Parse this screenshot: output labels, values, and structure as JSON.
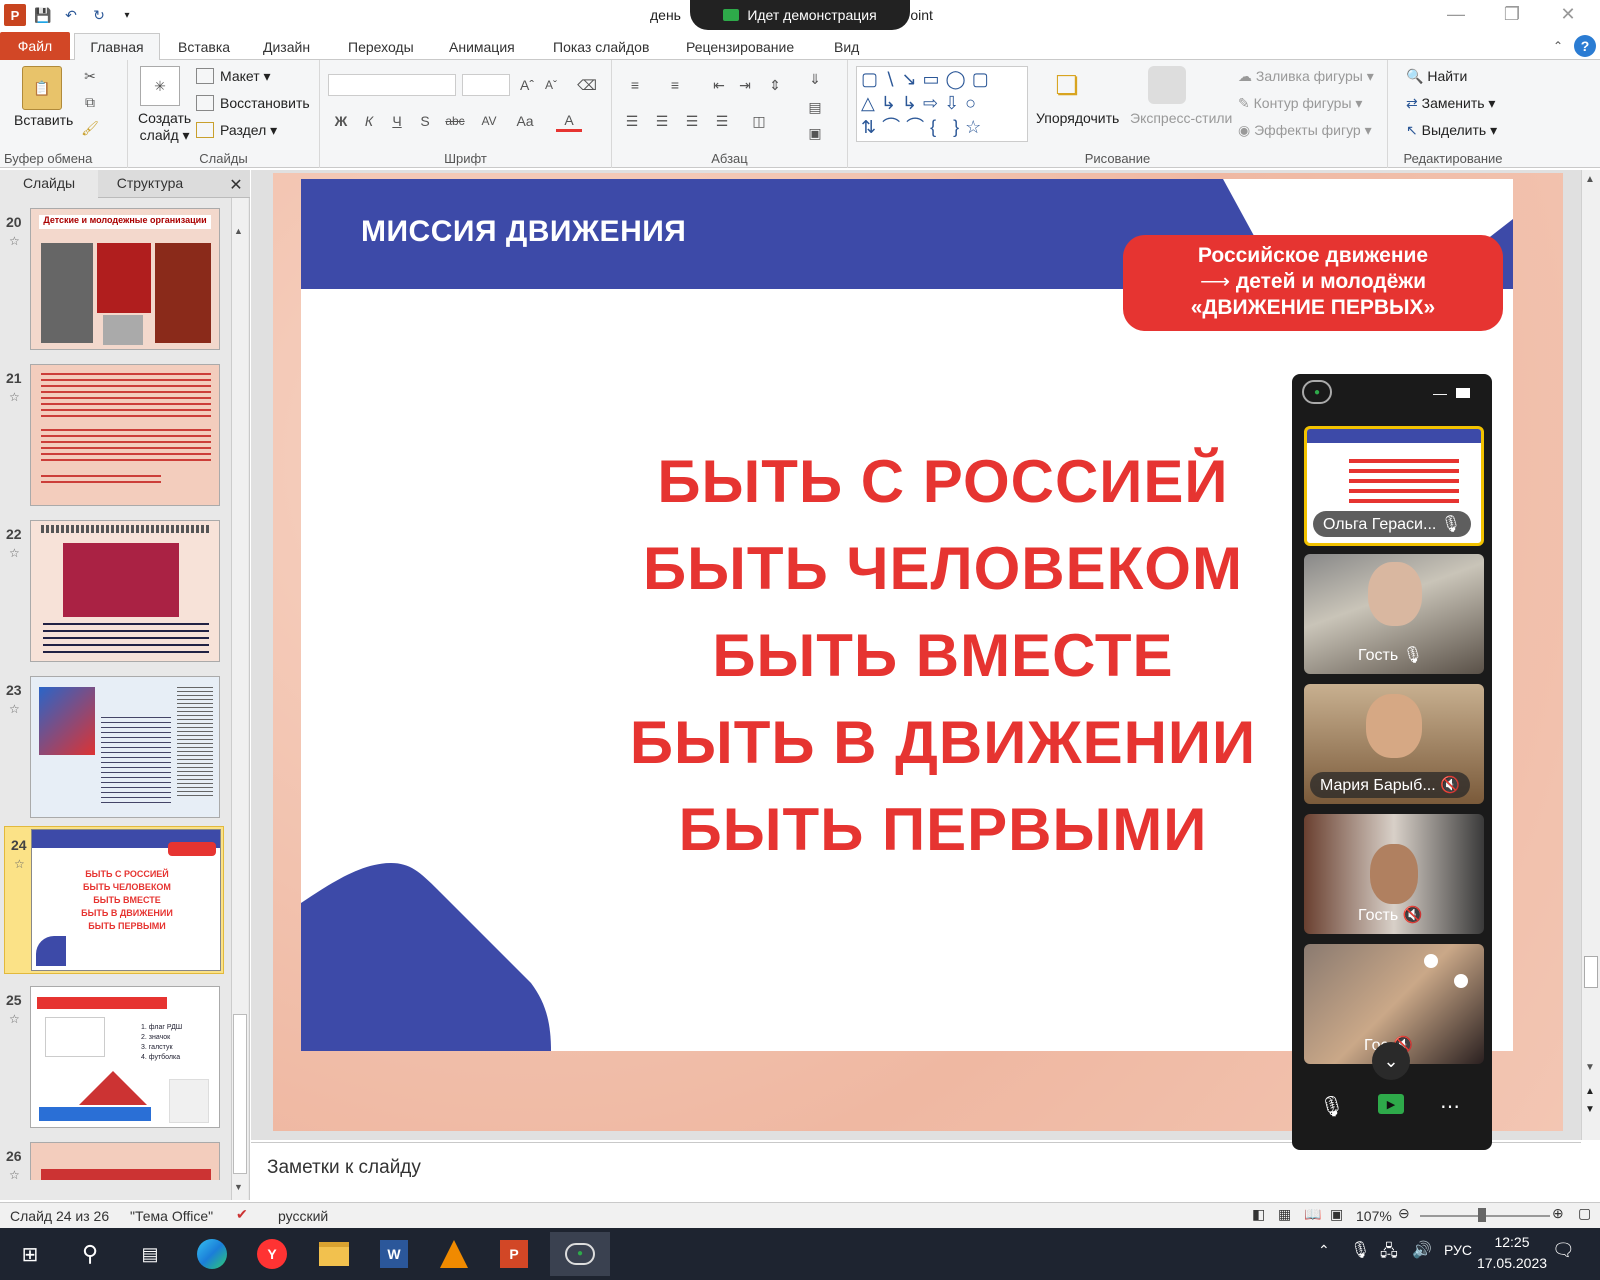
{
  "titlebar": {
    "title_left": "день",
    "title_right": "Point",
    "share_label": "Идет демонстрация",
    "app_badge": "P"
  },
  "tabs": [
    {
      "label": "Файл"
    },
    {
      "label": "Главная"
    },
    {
      "label": "Вставка"
    },
    {
      "label": "Дизайн"
    },
    {
      "label": "Переходы"
    },
    {
      "label": "Анимация"
    },
    {
      "label": "Показ слайдов"
    },
    {
      "label": "Рецензирование"
    },
    {
      "label": "Вид"
    }
  ],
  "ribbon": {
    "clipboard": {
      "paste": "Вставить",
      "label": "Буфер обмена"
    },
    "slides": {
      "new_slide_1": "Создать",
      "new_slide_2": "слайд",
      "layout": "Макет",
      "reset": "Восстановить",
      "section": "Раздел",
      "label": "Слайды"
    },
    "font": {
      "label": "Шрифт",
      "bold": "Ж",
      "italic": "К",
      "underline": "Ч",
      "shadow": "S",
      "strike": "abc",
      "spacing": "AV",
      "case": "Aa",
      "color": "A"
    },
    "paragraph": {
      "label": "Абзац"
    },
    "drawing": {
      "arrange": "Упорядочить",
      "quick_styles": "Экспресс-стили",
      "fill": "Заливка фигуры",
      "outline": "Контур фигуры",
      "effects": "Эффекты фигур",
      "label": "Рисование"
    },
    "editing": {
      "find": "Найти",
      "replace": "Заменить",
      "select": "Выделить",
      "label": "Редактирование"
    }
  },
  "leftpane": {
    "tab_slides": "Слайды",
    "tab_outline": "Структура",
    "thumbs": [
      {
        "num": "20",
        "title": "Детские и молодежные организации"
      },
      {
        "num": "21"
      },
      {
        "num": "22"
      },
      {
        "num": "23"
      },
      {
        "num": "24",
        "lines": [
          "БЫТЬ С РОССИЕЙ",
          "БЫТЬ ЧЕЛОВЕКОМ",
          "БЫТЬ ВМЕСТЕ",
          "БЫТЬ В ДВИЖЕНИИ",
          "БЫТЬ ПЕРВЫМИ"
        ]
      },
      {
        "num": "25",
        "items": [
          "1. флаг РДШ",
          "2. значок",
          "3. галстук",
          "4. футболка"
        ]
      },
      {
        "num": "26"
      }
    ]
  },
  "slide": {
    "header": "МИССИЯ ДВИЖЕНИЯ",
    "badge_line1": "Российское движение",
    "badge_line2": "детей и молодёжи",
    "badge_line3": "«ДВИЖЕНИЕ ПЕРВЫХ»",
    "slogans": [
      "БЫТЬ С РОССИЕЙ",
      "БЫТЬ ЧЕЛОВЕКОМ",
      "БЫТЬ ВМЕСТЕ",
      "БЫТЬ В ДВИЖЕНИИ",
      "БЫТЬ ПЕРВЫМИ"
    ]
  },
  "video": {
    "participants": [
      {
        "name": "Ольга Гераси...",
        "mic": "on"
      },
      {
        "name": "Гость",
        "mic": "on"
      },
      {
        "name": "Мария Барыб...",
        "mic": "off"
      },
      {
        "name": "Гость",
        "mic": "off"
      },
      {
        "name": "Гос",
        "mic": "off"
      }
    ]
  },
  "notes": {
    "placeholder": "Заметки к слайду"
  },
  "status": {
    "slide_counter": "Слайд 24 из 26",
    "theme": "\"Тема Office\"",
    "language": "русский",
    "zoom": "107%"
  },
  "taskbar": {
    "lang": "РУС",
    "time": "12:25",
    "date": "17.05.2023"
  },
  "colors": {
    "accent_red": "#e63431",
    "accent_blue": "#3d4aa8",
    "file_tab": "#d24726"
  }
}
